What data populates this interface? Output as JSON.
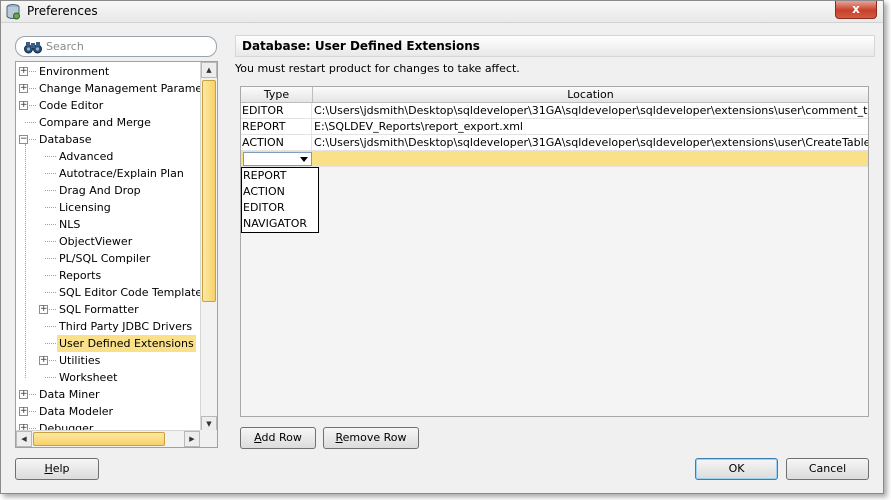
{
  "window": {
    "title": "Preferences",
    "close_glyph": "x",
    "icon": "preferences-db-icon"
  },
  "search": {
    "placeholder": "Search",
    "value": ""
  },
  "tree": {
    "items": [
      {
        "label": "Environment",
        "level": 0,
        "expandable": true,
        "expanded": false
      },
      {
        "label": "Change Management Parameters",
        "level": 0,
        "expandable": true,
        "expanded": false
      },
      {
        "label": "Code Editor",
        "level": 0,
        "expandable": true,
        "expanded": false
      },
      {
        "label": "Compare and Merge",
        "level": 0,
        "expandable": false
      },
      {
        "label": "Database",
        "level": 0,
        "expandable": true,
        "expanded": true
      },
      {
        "label": "Advanced",
        "level": 1,
        "expandable": false
      },
      {
        "label": "Autotrace/Explain Plan",
        "level": 1,
        "expandable": false
      },
      {
        "label": "Drag And Drop",
        "level": 1,
        "expandable": false
      },
      {
        "label": "Licensing",
        "level": 1,
        "expandable": false
      },
      {
        "label": "NLS",
        "level": 1,
        "expandable": false
      },
      {
        "label": "ObjectViewer",
        "level": 1,
        "expandable": false
      },
      {
        "label": "PL/SQL Compiler",
        "level": 1,
        "expandable": false
      },
      {
        "label": "Reports",
        "level": 1,
        "expandable": false
      },
      {
        "label": "SQL Editor Code Templates",
        "level": 1,
        "expandable": false
      },
      {
        "label": "SQL Formatter",
        "level": 1,
        "expandable": true,
        "expanded": false
      },
      {
        "label": "Third Party JDBC Drivers",
        "level": 1,
        "expandable": false
      },
      {
        "label": "User Defined Extensions",
        "level": 1,
        "expandable": false,
        "selected": true
      },
      {
        "label": "Utilities",
        "level": 1,
        "expandable": true,
        "expanded": false
      },
      {
        "label": "Worksheet",
        "level": 1,
        "expandable": false
      },
      {
        "label": "Data Miner",
        "level": 0,
        "expandable": true,
        "expanded": false
      },
      {
        "label": "Data Modeler",
        "level": 0,
        "expandable": true,
        "expanded": false
      },
      {
        "label": "Debugger",
        "level": 0,
        "expandable": true,
        "expanded": false
      }
    ]
  },
  "content": {
    "title": "Database: User Defined Extensions",
    "message": "You must restart product for changes to take affect.",
    "table": {
      "columns": [
        "Type",
        "Location"
      ],
      "rows": [
        {
          "type": "EDITOR",
          "location": "C:\\Users\\jdsmith\\Desktop\\sqldeveloper\\31GA\\sqldeveloper\\sqldeveloper\\extensions\\user\\comment_tab.xml"
        },
        {
          "type": "REPORT",
          "location": "E:\\SQLDEV_Reports\\report_export.xml"
        },
        {
          "type": "ACTION",
          "location": "C:\\Users\\jdsmith\\Desktop\\sqldeveloper\\31GA\\sqldeveloper\\sqldeveloper\\extensions\\user\\CreateTableSyn.xml"
        }
      ],
      "editing_row": {
        "type": "",
        "location": ""
      },
      "type_options": [
        "REPORT",
        "ACTION",
        "EDITOR",
        "NAVIGATOR"
      ]
    },
    "add_row": {
      "mnemonic": "A",
      "rest": "dd Row"
    },
    "remove_row": {
      "mnemonic": "R",
      "rest": "emove Row"
    }
  },
  "footer": {
    "help": {
      "mnemonic": "H",
      "rest": "elp"
    },
    "ok_label": "OK",
    "cancel_label": "Cancel"
  },
  "colors": {
    "selection": "#fbe08a",
    "scroll_thumb": "#f7d166",
    "close": "#c7402a"
  }
}
